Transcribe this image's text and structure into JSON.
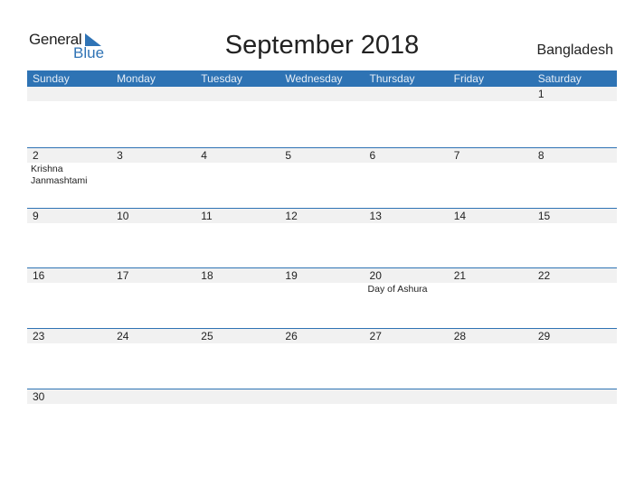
{
  "logo": {
    "line1": "General",
    "line2": "Blue"
  },
  "title": "September 2018",
  "country": "Bangladesh",
  "weekdays": [
    "Sunday",
    "Monday",
    "Tuesday",
    "Wednesday",
    "Thursday",
    "Friday",
    "Saturday"
  ],
  "weeks": [
    [
      {
        "d": ""
      },
      {
        "d": ""
      },
      {
        "d": ""
      },
      {
        "d": ""
      },
      {
        "d": ""
      },
      {
        "d": ""
      },
      {
        "d": "1"
      }
    ],
    [
      {
        "d": "2",
        "ev": "Krishna Janmashtami"
      },
      {
        "d": "3"
      },
      {
        "d": "4"
      },
      {
        "d": "5"
      },
      {
        "d": "6"
      },
      {
        "d": "7"
      },
      {
        "d": "8"
      }
    ],
    [
      {
        "d": "9"
      },
      {
        "d": "10"
      },
      {
        "d": "11"
      },
      {
        "d": "12"
      },
      {
        "d": "13"
      },
      {
        "d": "14"
      },
      {
        "d": "15"
      }
    ],
    [
      {
        "d": "16"
      },
      {
        "d": "17"
      },
      {
        "d": "18"
      },
      {
        "d": "19"
      },
      {
        "d": "20",
        "ev": "Day of Ashura"
      },
      {
        "d": "21"
      },
      {
        "d": "22"
      }
    ],
    [
      {
        "d": "23"
      },
      {
        "d": "24"
      },
      {
        "d": "25"
      },
      {
        "d": "26"
      },
      {
        "d": "27"
      },
      {
        "d": "28"
      },
      {
        "d": "29"
      }
    ],
    [
      {
        "d": "30"
      },
      {
        "d": ""
      },
      {
        "d": ""
      },
      {
        "d": ""
      },
      {
        "d": ""
      },
      {
        "d": ""
      },
      {
        "d": ""
      }
    ]
  ],
  "colors": {
    "accent": "#2e73b4",
    "band": "#f1f1f1"
  }
}
